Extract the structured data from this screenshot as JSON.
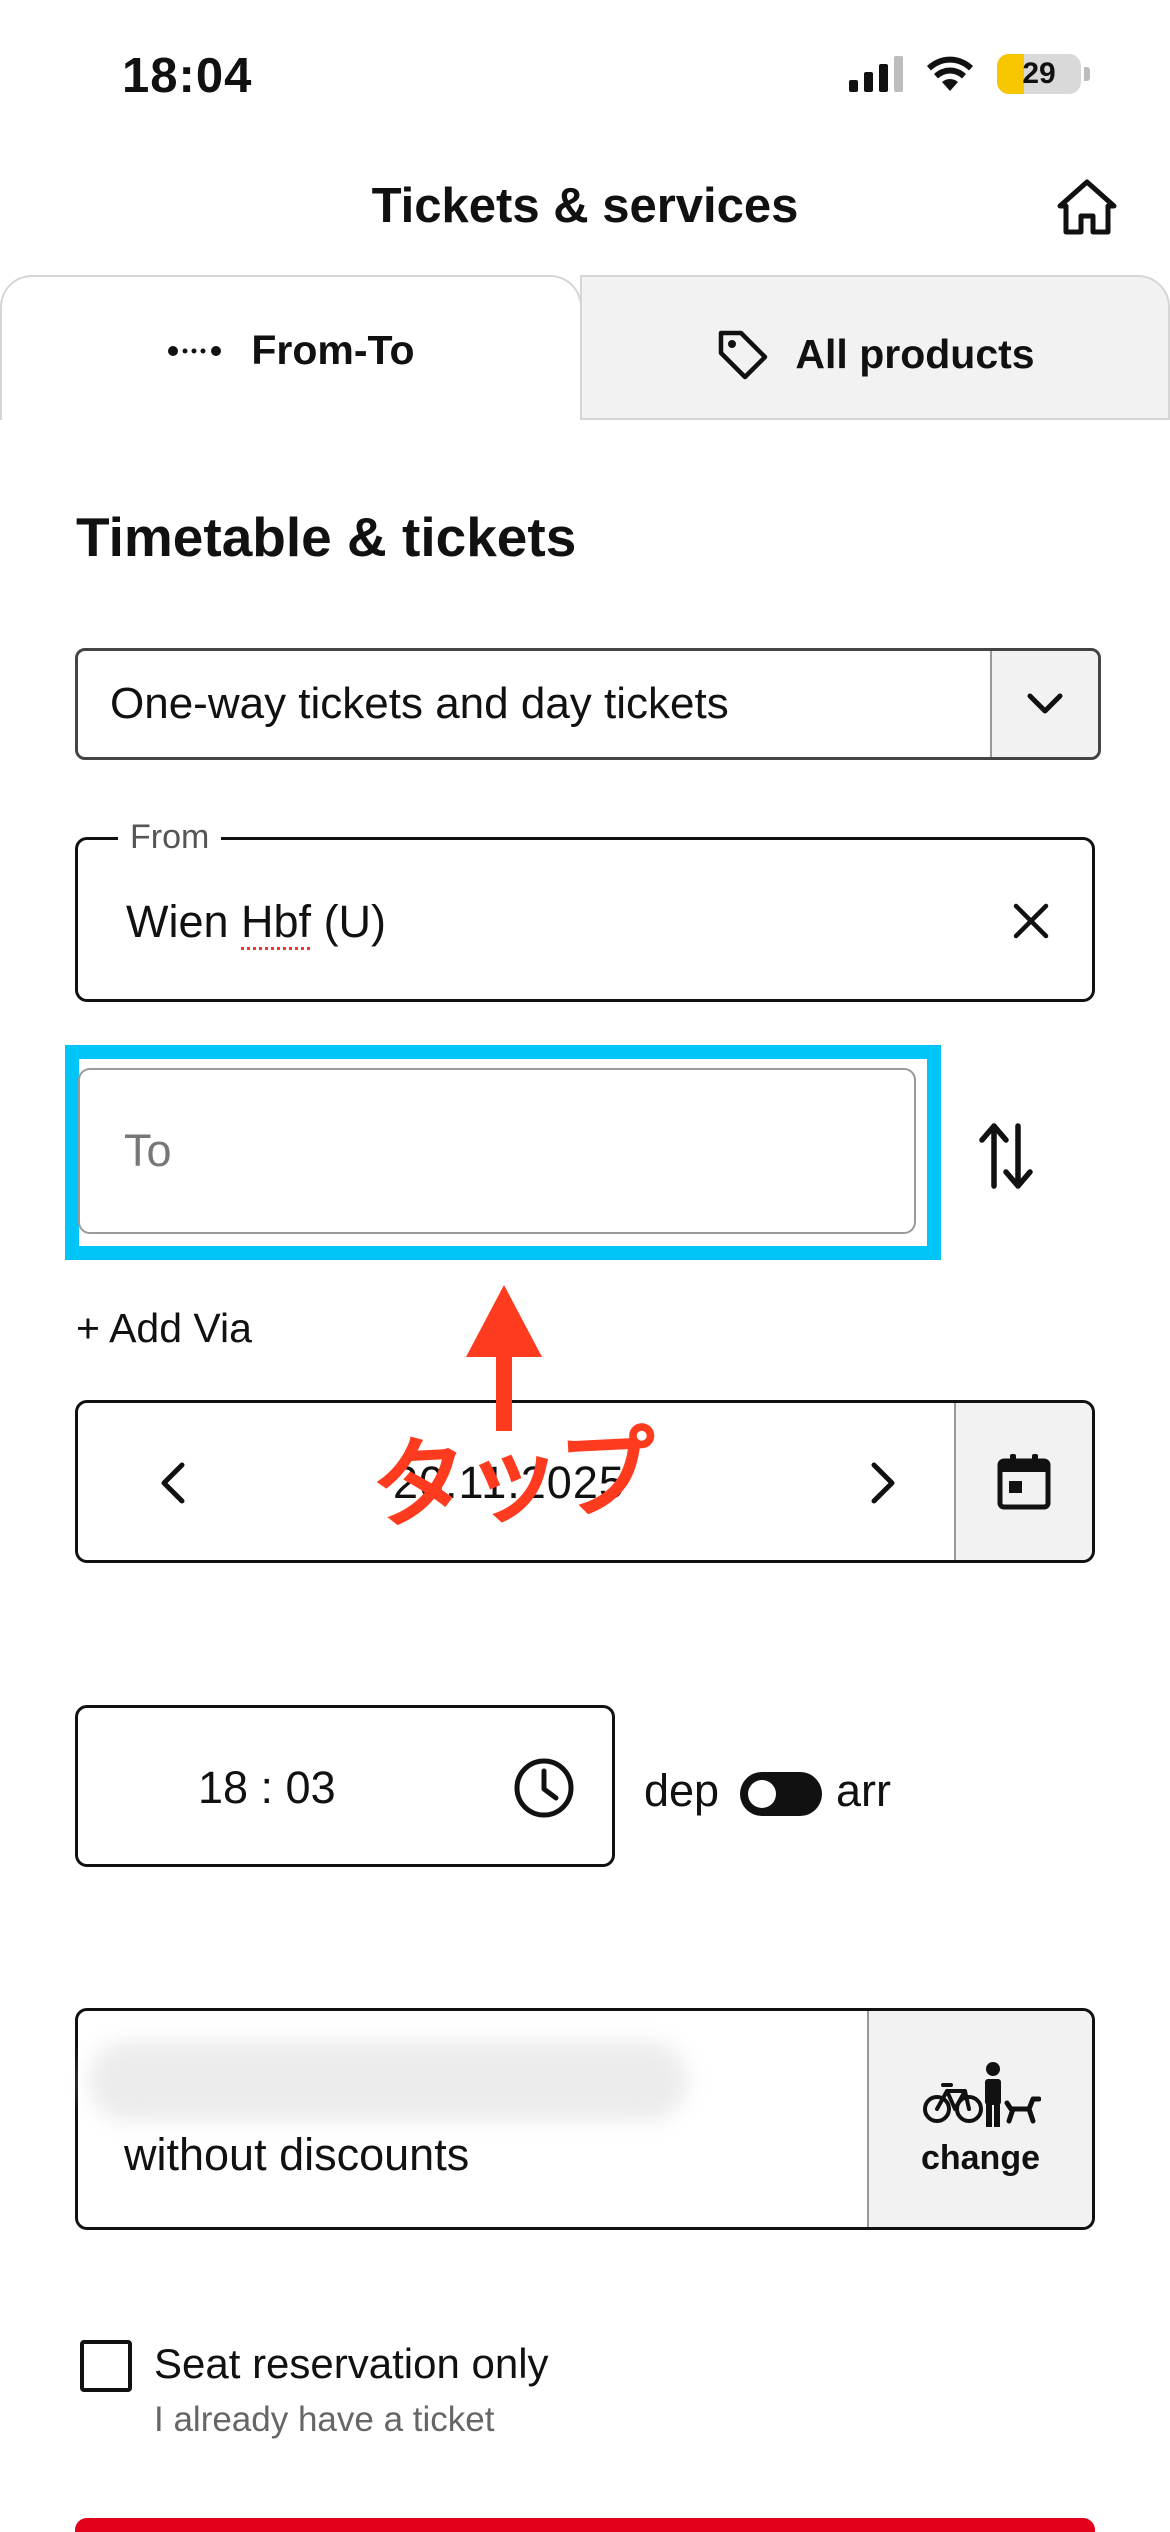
{
  "status_bar": {
    "time": "18:04",
    "battery": "29"
  },
  "header": {
    "title": "Tickets & services"
  },
  "tabs": [
    {
      "label": "From-To",
      "active": true
    },
    {
      "label": "All products",
      "active": false
    }
  ],
  "section": {
    "title": "Timetable & tickets"
  },
  "ticket_type": {
    "selected": "One-way tickets and day tickets"
  },
  "from": {
    "legend": "From",
    "value_prefix": "Wien ",
    "value_marked": "Hbf",
    "value_suffix": " (U)"
  },
  "to": {
    "placeholder": "To"
  },
  "add_via": {
    "label": "+ Add Via"
  },
  "date": {
    "value": "20.11.2025"
  },
  "annotation": {
    "text": "タップ",
    "color": "#ff3b1f",
    "highlight_color": "#00c5f6"
  },
  "time": {
    "value": "18 : 03",
    "dep_label": "dep",
    "arr_label": "arr"
  },
  "passengers": {
    "discount": "without discounts",
    "change_label": "change"
  },
  "seat_reservation": {
    "label": "Seat reservation only",
    "sublabel": "I already have a ticket",
    "checked": false
  },
  "colors": {
    "accent": "#e2001a"
  }
}
